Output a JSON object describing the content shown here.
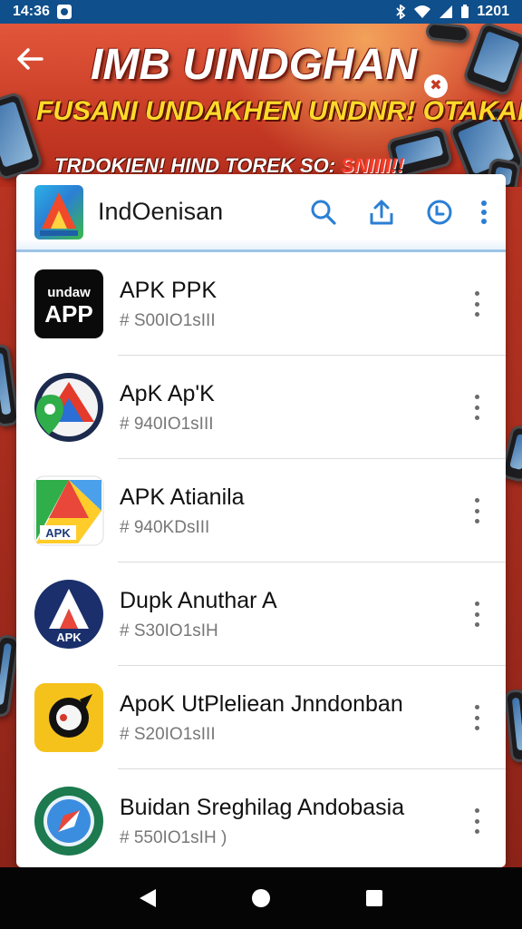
{
  "status_bar": {
    "time": "14:36",
    "battery_text": "1201"
  },
  "banner": {
    "title": "IMB UINDGHAN",
    "subtitle": "FUSANI UNDAKHEN UNDNR! OTAKAN",
    "tagline_white": "TRDOKIEN! HIND TOREK SO: ",
    "tagline_red": "SNIIII!!"
  },
  "app_bar": {
    "title": "IndOenisan"
  },
  "apps": [
    {
      "title": "APK PPK",
      "subtitle": "#  S00IO1sIII",
      "icon": "apk-app-black-icon"
    },
    {
      "title": "ApK Ap'K",
      "subtitle": "#  940IO1sIII",
      "icon": "apk-maps-circle-icon"
    },
    {
      "title": "APK Atianila",
      "subtitle": "#  940KDsIII",
      "icon": "apk-drive-icon"
    },
    {
      "title": "Dupk Anuthar A",
      "subtitle": "#  S30IO1sIH",
      "icon": "apk-blue-circle-icon"
    },
    {
      "title": "ApoK UtPleliean Jnndonban",
      "subtitle": "#  S20IO1sIII",
      "icon": "apk-yellow-icon"
    },
    {
      "title": "Buidan Sreghilag Andobasia",
      "subtitle": "#  550IO1sIH )",
      "icon": "apk-green-globe-icon"
    }
  ],
  "colors": {
    "status_bar": "#0f4f8c",
    "banner_red": "#c63a24",
    "accent_blue": "#2b7fd4",
    "banner_yellow": "#ffd92a"
  }
}
